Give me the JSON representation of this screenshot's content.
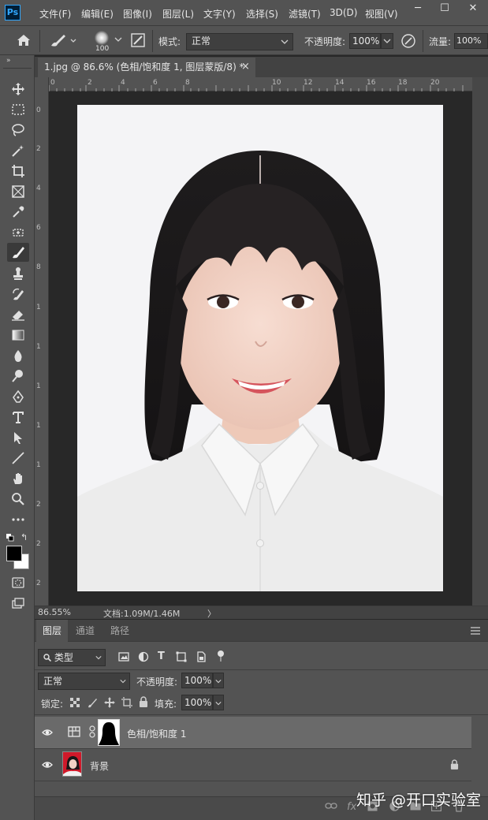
{
  "app": {
    "logo": "Ps"
  },
  "menu": {
    "items": [
      "文件(F)",
      "编辑(E)",
      "图像(I)",
      "图层(L)",
      "文字(Y)",
      "选择(S)",
      "滤镜(T)",
      "3D(D)",
      "视图(V)"
    ],
    "window_controls": {
      "minimize": "─",
      "maximize": "☐",
      "close": "✕"
    }
  },
  "options": {
    "brush_size": "100",
    "mode_label": "模式:",
    "mode_value": "正常",
    "opacity_label": "不透明度:",
    "opacity_value": "100%",
    "flow_label": "流量:",
    "flow_value": "100%"
  },
  "document": {
    "tab_title": "1.jpg @ 86.6% (色相/饱和度 1, 图层蒙版/8) *",
    "close": "×",
    "ruler_top": [
      "0",
      "2",
      "4",
      "6",
      "8",
      "10",
      "12",
      "14",
      "16",
      "18",
      "20"
    ],
    "ruler_left": [
      "0",
      "2",
      "4",
      "6",
      "8",
      "1",
      "1",
      "1",
      "1",
      "1",
      "2",
      "2",
      "2"
    ]
  },
  "status": {
    "zoom": "86.55%",
    "doc_info": "文档:1.09M/1.46M",
    "arrow": "〉"
  },
  "layers_panel": {
    "tabs": [
      "图层",
      "通道",
      "路径"
    ],
    "filter_label": "类型",
    "blend_mode": "正常",
    "opacity_label": "不透明度:",
    "opacity_value": "100%",
    "lock_label": "锁定:",
    "fill_label": "填充:",
    "fill_value": "100%",
    "layers": [
      {
        "name": "色相/饱和度 1",
        "selected": true
      },
      {
        "name": "背景",
        "locked": true
      }
    ],
    "footer_fx": "fx"
  },
  "watermark": "知乎 @开口实验室",
  "colors": {
    "ui_bg": "#535353",
    "ui_dark": "#424242",
    "canvas_bg": "#282828",
    "selected_layer": "#6a6a6a",
    "id_photo_red": "#d0192a"
  }
}
